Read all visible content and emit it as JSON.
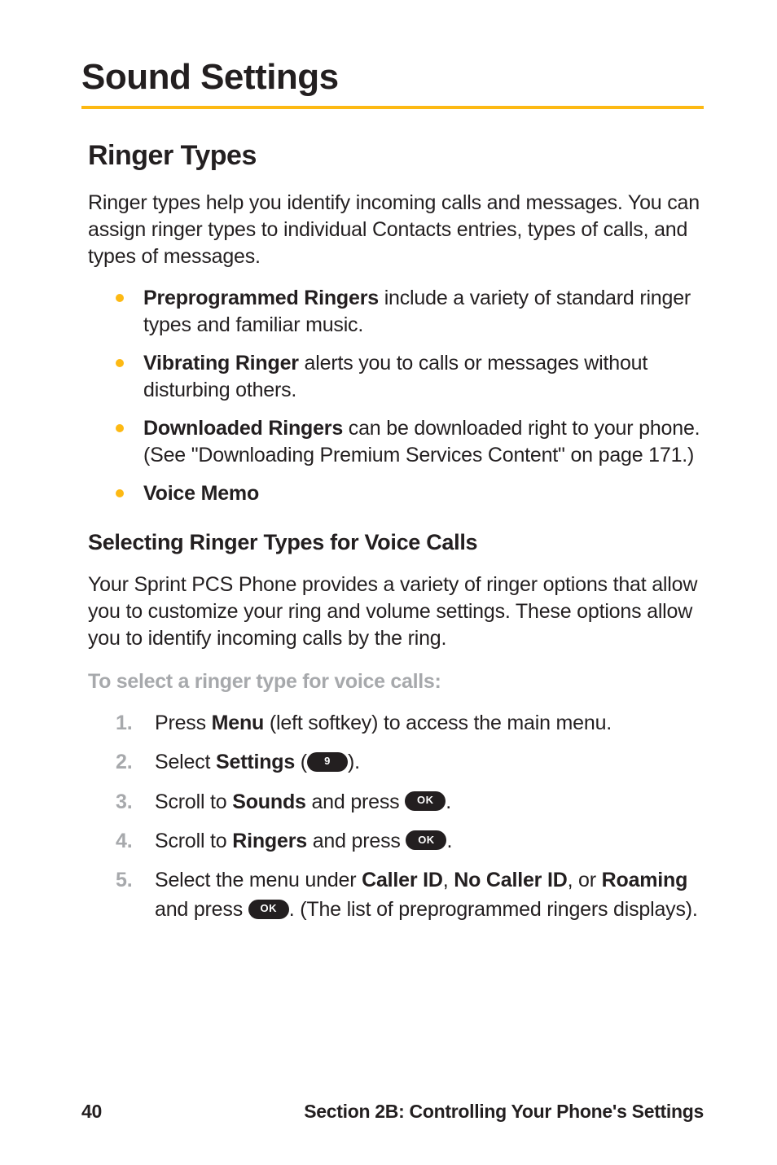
{
  "page_title": "Sound Settings",
  "section_heading": "Ringer Types",
  "intro": "Ringer types help you identify incoming calls and messages. You can assign ringer types to individual Contacts entries, types of calls, and types of messages.",
  "bullets": [
    {
      "bold": "Preprogrammed Ringers",
      "rest": " include a variety of standard ringer types and familiar music."
    },
    {
      "bold": "Vibrating Ringer",
      "rest": " alerts you to calls or messages without disturbing others."
    },
    {
      "bold": "Downloaded Ringers",
      "rest": " can be downloaded right to your phone. (See \"Downloading Premium Services Content\" on page 171.)"
    },
    {
      "bold": "Voice Memo",
      "rest": ""
    }
  ],
  "subheading": "Selecting Ringer Types for Voice Calls",
  "para": "Your Sprint PCS Phone provides a variety of ringer options that allow you to customize your ring and volume settings. These options allow you to identify incoming calls by the ring.",
  "instruction_label": "To select a ringer type for voice calls:",
  "steps": {
    "s1": {
      "num": "1.",
      "pre": "Press ",
      "bold": "Menu",
      "post": " (left softkey) to access the main menu."
    },
    "s2": {
      "num": "2.",
      "pre": "Select ",
      "bold": "Settings",
      "open": " (",
      "key": "9",
      "close": ")."
    },
    "s3": {
      "num": "3.",
      "pre": "Scroll to ",
      "bold": "Sounds",
      "mid": " and press ",
      "key": "OK",
      "post": "."
    },
    "s4": {
      "num": "4.",
      "pre": "Scroll to ",
      "bold": "Ringers",
      "mid": " and press ",
      "key": "OK",
      "post": "."
    },
    "s5": {
      "num": "5.",
      "pre": "Select the menu under ",
      "b1": "Caller ID",
      "c1": ", ",
      "b2": "No Caller ID",
      "c2": ", or ",
      "b3": "Roaming",
      "mid": " and press ",
      "key": "OK",
      "post": ". (The list of preprogrammed ringers displays)."
    }
  },
  "footer": {
    "page_num": "40",
    "section_label": "Section 2B: Controlling Your Phone's Settings"
  }
}
